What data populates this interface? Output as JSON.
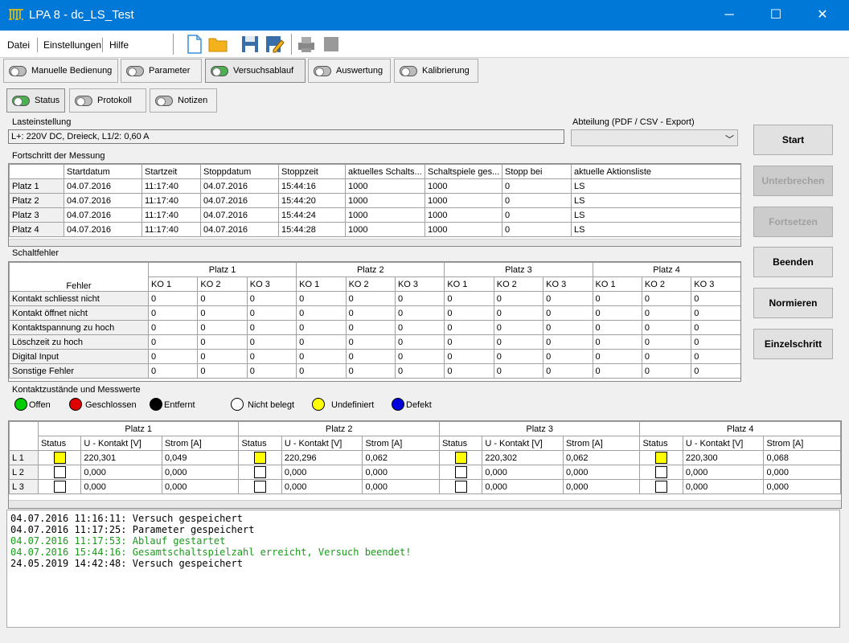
{
  "window": {
    "title": "LPA 8 - dc_LS_Test",
    "min": "─",
    "max": "☐",
    "close": "✕"
  },
  "menu": [
    "Datei",
    "Einstellungen",
    "Hilfe"
  ],
  "tabs1": [
    {
      "label": "Manuelle Bedienung",
      "on": false
    },
    {
      "label": "Parameter",
      "on": false
    },
    {
      "label": "Versuchsablauf",
      "on": true
    },
    {
      "label": "Auswertung",
      "on": false
    },
    {
      "label": "Kalibrierung",
      "on": false
    }
  ],
  "tabs2": [
    {
      "label": "Status",
      "on": true
    },
    {
      "label": "Protokoll",
      "on": false
    },
    {
      "label": "Notizen",
      "on": false
    }
  ],
  "last": {
    "label": "Lasteinstellung",
    "value": "L+: 220V DC, Dreieck, L1/2: 0,60 A"
  },
  "abteilung": {
    "label": "Abteilung (PDF / CSV - Export)",
    "value": ""
  },
  "progress": {
    "label": "Fortschritt der Messung",
    "headers": [
      "",
      "Startdatum",
      "Startzeit",
      "Stoppdatum",
      "Stoppzeit",
      "aktuelles Schalts...",
      "Schaltspiele ges...",
      "Stopp bei",
      "aktuelle Aktionsliste"
    ],
    "rows": [
      [
        "Platz 1",
        "04.07.2016",
        "11:17:40",
        "04.07.2016",
        "15:44:16",
        "1000",
        "1000",
        "0",
        "LS"
      ],
      [
        "Platz 2",
        "04.07.2016",
        "11:17:40",
        "04.07.2016",
        "15:44:20",
        "1000",
        "1000",
        "0",
        "LS"
      ],
      [
        "Platz 3",
        "04.07.2016",
        "11:17:40",
        "04.07.2016",
        "15:44:24",
        "1000",
        "1000",
        "0",
        "LS"
      ],
      [
        "Platz 4",
        "04.07.2016",
        "11:17:40",
        "04.07.2016",
        "15:44:28",
        "1000",
        "1000",
        "0",
        "LS"
      ]
    ]
  },
  "faults": {
    "label": "Schaltfehler",
    "col": "Fehler",
    "places": [
      "Platz 1",
      "Platz 2",
      "Platz 3",
      "Platz 4"
    ],
    "ko": [
      "KO 1",
      "KO 2",
      "KO 3"
    ],
    "rows": [
      "Kontakt schliesst nicht",
      "Kontakt öffnet nicht",
      "Kontaktspannung zu hoch",
      "Löschzeit zu hoch",
      "Digital Input",
      "Sonstige Fehler"
    ],
    "value": "0"
  },
  "states": {
    "label": "Kontaktzustände und Messwerte",
    "legend": [
      {
        "t": "Offen",
        "c": "#00cc00"
      },
      {
        "t": "Geschlossen",
        "c": "#e00000"
      },
      {
        "t": "Entfernt",
        "c": "#000000"
      },
      {
        "t": "Nicht belegt",
        "c": "#ffffff"
      },
      {
        "t": "Undefiniert",
        "c": "#ffff00"
      },
      {
        "t": "Defekt",
        "c": "#0000dd"
      }
    ],
    "places": [
      "Platz 1",
      "Platz 2",
      "Platz 3",
      "Platz 4"
    ],
    "sub": [
      "Status",
      "U - Kontakt [V]",
      "Strom [A]"
    ],
    "rows": [
      {
        "l": "L 1",
        "v": [
          [
            "220,301",
            "0,049"
          ],
          [
            "220,296",
            "0,062"
          ],
          [
            "220,302",
            "0,062"
          ],
          [
            "220,300",
            "0,068"
          ]
        ],
        "y": true
      },
      {
        "l": "L 2",
        "v": [
          [
            "0,000",
            "0,000"
          ],
          [
            "0,000",
            "0,000"
          ],
          [
            "0,000",
            "0,000"
          ],
          [
            "0,000",
            "0,000"
          ]
        ],
        "y": false
      },
      {
        "l": "L 3",
        "v": [
          [
            "0,000",
            "0,000"
          ],
          [
            "0,000",
            "0,000"
          ],
          [
            "0,000",
            "0,000"
          ],
          [
            "0,000",
            "0,000"
          ]
        ],
        "y": false
      }
    ]
  },
  "buttons": [
    {
      "t": "Start",
      "d": false
    },
    {
      "t": "Unterbrechen",
      "d": true
    },
    {
      "t": "Fortsetzen",
      "d": true
    },
    {
      "t": "Beenden",
      "d": false
    },
    {
      "t": "Normieren",
      "d": false
    },
    {
      "t": "Einzelschritt",
      "d": false
    }
  ],
  "log": [
    {
      "t": "04.07.2016 11:16:11: Versuch gespeichert",
      "g": false
    },
    {
      "t": "04.07.2016 11:17:25: Parameter gespeichert",
      "g": false
    },
    {
      "t": "04.07.2016 11:17:53: Ablauf gestartet",
      "g": true
    },
    {
      "t": "04.07.2016 15:44:16: Gesamtschaltspielzahl erreicht, Versuch beendet!",
      "g": true
    },
    {
      "t": "24.05.2019 14:42:48: Versuch gespeichert",
      "g": false
    }
  ]
}
